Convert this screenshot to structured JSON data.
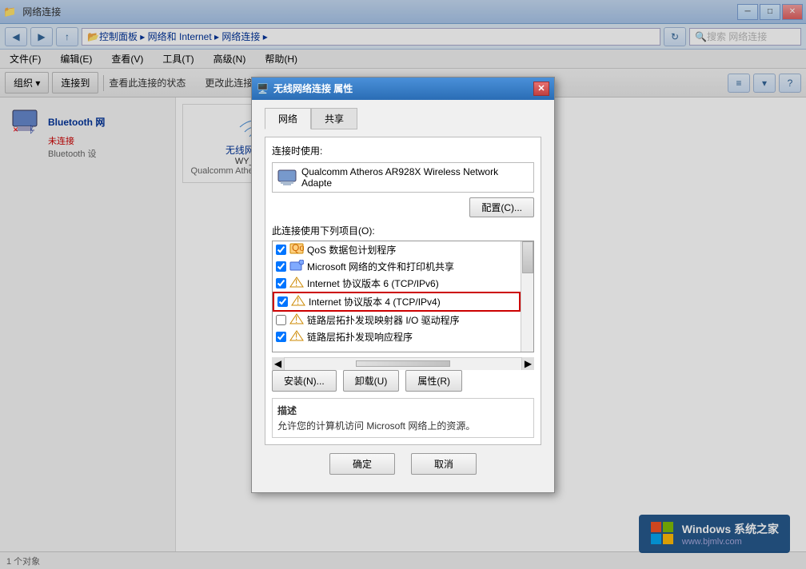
{
  "window": {
    "title": "网络连接",
    "address": "控制面板 ▸ 网络和 Internet ▸ 网络连接 ▸",
    "search_placeholder": "搜索 网络连接"
  },
  "menubar": {
    "items": [
      "文件(F)",
      "编辑(E)",
      "查看(V)",
      "工具(T)",
      "高级(N)",
      "帮助(H)"
    ]
  },
  "toolbar": {
    "organize": "组织 ▾",
    "connect": "连接到",
    "view_status": "查看此连接的状态",
    "change_settings": "更改此连接的设置"
  },
  "left_panel": {
    "bluetooth_label": "Bluetooth 网",
    "bluetooth_status": "未连接",
    "bluetooth_sublabel": "Bluetooth 设",
    "error_label": "×"
  },
  "right_panel": {
    "wireless_name": "无线网络连接",
    "wireless_ssid": "WY_0306",
    "wireless_adapter": "Qualcomm Atheros AR928X W..."
  },
  "dialog": {
    "title": "无线网络连接 属性",
    "tabs": [
      "网络",
      "共享"
    ],
    "active_tab": "网络",
    "connect_using_label": "连接时使用:",
    "adapter_name": "Qualcomm Atheros AR928X Wireless Network Adapte",
    "config_btn": "配置(C)...",
    "items_label": "此连接使用下列项目(O):",
    "list_items": [
      {
        "checked": true,
        "label": "QoS 数据包计划程序",
        "icon": "qos"
      },
      {
        "checked": true,
        "label": "Microsoft 网络的文件和打印机共享",
        "icon": "share"
      },
      {
        "checked": true,
        "label": "Internet 协议版本 6 (TCP/IPv6)",
        "icon": "network"
      },
      {
        "checked": true,
        "label": "Internet 协议版本 4 (TCP/IPv4)",
        "icon": "network",
        "selected": true
      },
      {
        "checked": false,
        "label": "链路层拓扑发现映射器 I/O 驱动程序",
        "icon": "network"
      },
      {
        "checked": true,
        "label": "链路层拓扑发现响应程序",
        "icon": "network"
      }
    ],
    "install_btn": "安装(N)...",
    "uninstall_btn": "卸载(U)",
    "properties_btn": "属性(R)",
    "description_title": "描述",
    "description_text": "允许您的计算机访问 Microsoft 网络上的资源。",
    "ok_btn": "确定",
    "cancel_btn": "取消"
  },
  "watermark": {
    "line1": "Windows 系统之家",
    "line2": "www.bjmlv.com"
  },
  "icons": {
    "back": "◀",
    "forward": "▶",
    "refresh": "↑",
    "search": "🔍",
    "close": "✕",
    "minimize": "─",
    "maximize": "□"
  }
}
